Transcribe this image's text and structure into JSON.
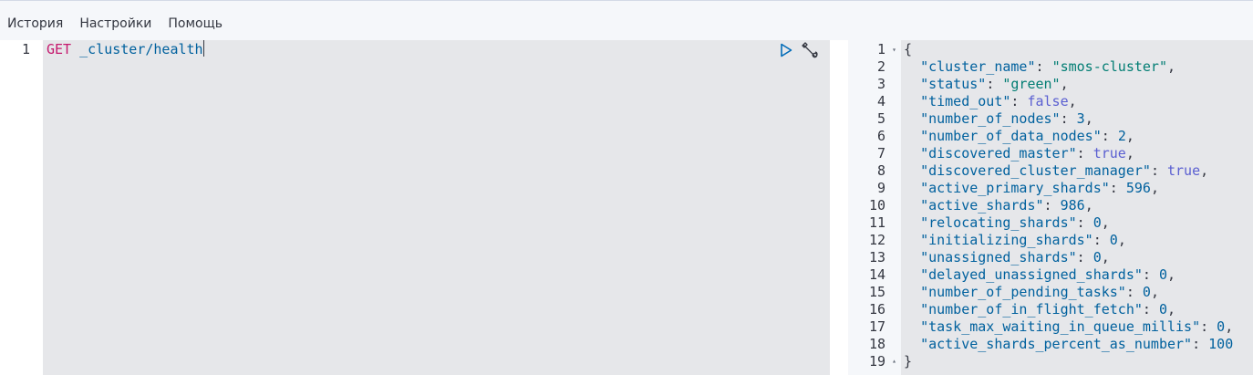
{
  "menu": {
    "items": [
      "История",
      "Настройки",
      "Помощь"
    ]
  },
  "request": {
    "line_number": "1",
    "method": "GET",
    "path": "_cluster/health"
  },
  "icons": {
    "run": "play-icon",
    "settings": "wrench-icon"
  },
  "response": {
    "open_brace": "{",
    "close_brace": "}",
    "line_numbers": [
      "1",
      "2",
      "3",
      "4",
      "5",
      "6",
      "7",
      "8",
      "9",
      "10",
      "11",
      "12",
      "13",
      "14",
      "15",
      "16",
      "17",
      "18",
      "19"
    ],
    "fields": [
      {
        "key": "\"cluster_name\"",
        "value": "\"smos-cluster\"",
        "type": "string",
        "trail": ","
      },
      {
        "key": "\"status\"",
        "value": "\"green\"",
        "type": "string",
        "trail": ","
      },
      {
        "key": "\"timed_out\"",
        "value": "false",
        "type": "bool",
        "trail": ","
      },
      {
        "key": "\"number_of_nodes\"",
        "value": "3",
        "type": "number",
        "trail": ","
      },
      {
        "key": "\"number_of_data_nodes\"",
        "value": "2",
        "type": "number",
        "trail": ","
      },
      {
        "key": "\"discovered_master\"",
        "value": "true",
        "type": "bool",
        "trail": ","
      },
      {
        "key": "\"discovered_cluster_manager\"",
        "value": "true",
        "type": "bool",
        "trail": ","
      },
      {
        "key": "\"active_primary_shards\"",
        "value": "596",
        "type": "number",
        "trail": ","
      },
      {
        "key": "\"active_shards\"",
        "value": "986",
        "type": "number",
        "trail": ","
      },
      {
        "key": "\"relocating_shards\"",
        "value": "0",
        "type": "number",
        "trail": ","
      },
      {
        "key": "\"initializing_shards\"",
        "value": "0",
        "type": "number",
        "trail": ","
      },
      {
        "key": "\"unassigned_shards\"",
        "value": "0",
        "type": "number",
        "trail": ","
      },
      {
        "key": "\"delayed_unassigned_shards\"",
        "value": "0",
        "type": "number",
        "trail": ","
      },
      {
        "key": "\"number_of_pending_tasks\"",
        "value": "0",
        "type": "number",
        "trail": ","
      },
      {
        "key": "\"number_of_in_flight_fetch\"",
        "value": "0",
        "type": "number",
        "trail": ","
      },
      {
        "key": "\"task_max_waiting_in_queue_millis\"",
        "value": "0",
        "type": "number",
        "trail": ","
      },
      {
        "key": "\"active_shards_percent_as_number\"",
        "value": "100",
        "type": "number",
        "trail": ""
      }
    ]
  },
  "colors": {
    "method": "#c5196e",
    "key": "#00619e",
    "string": "#017d73",
    "bool": "#5a5fd1",
    "editor_bg": "#e6e7ea",
    "run_icon": "#006bb8"
  }
}
